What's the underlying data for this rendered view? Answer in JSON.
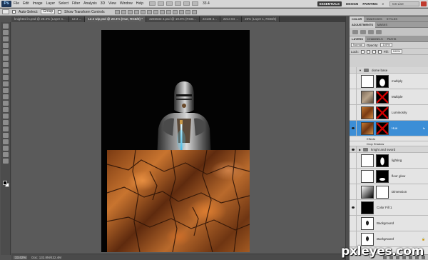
{
  "app": {
    "logo": "Ps",
    "menu": [
      "File",
      "Edit",
      "Image",
      "Layer",
      "Select",
      "Filter",
      "Analysis",
      "3D",
      "View",
      "Window",
      "Help"
    ],
    "zoom": "33.4",
    "workspaces": [
      "ESSENTIALS",
      "DESIGN",
      "PAINTING",
      "»"
    ],
    "cs_live": "CS Live"
  },
  "options": {
    "auto_select_label": "Auto-Select:",
    "auto_select_value": "Group",
    "show_transform_label": "Show Transform Controls"
  },
  "tabs": [
    "knighted in.psd @ 28.4% (Layer 4...",
    "12.4 ...",
    "12.4 wip.psd @ 28.4% (Hue, RGB/8) *",
    "3265533 4.psd @ 19.8% (RGB...",
    "22135 4...",
    "2214 84 ...",
    "26% (Layer 1, RGB/8)"
  ],
  "status": {
    "zoom": "33.42%",
    "doc": "Doc: 132.8M/432.4M"
  },
  "panels": {
    "top_tabs": [
      "COLOR",
      "SWATCHES",
      "STYLES"
    ],
    "mid_tabs": [
      "ADJUSTMENTS",
      "MASKS"
    ],
    "layer_tabs": [
      "LAYERS",
      "CHANNELS",
      "PATHS"
    ],
    "blend_mode": "Normal",
    "opacity_label": "Opacity:",
    "opacity_value": "100%",
    "lock_label": "Lock:",
    "fill_label": "Fill:",
    "fill_value": "100%"
  },
  "layers": [
    {
      "kind": "group",
      "name": "dome base"
    },
    {
      "kind": "layer",
      "name": "multiply"
    },
    {
      "kind": "layer",
      "name": "Multiple"
    },
    {
      "kind": "layer",
      "name": "Luminosity"
    },
    {
      "kind": "layer",
      "name": "Hue",
      "selected": true,
      "fx": "fx"
    },
    {
      "kind": "fxrow",
      "name": "Effects"
    },
    {
      "kind": "fxrow",
      "name": "Drop Shadow"
    },
    {
      "kind": "group",
      "name": "knight and sword"
    },
    {
      "kind": "layer",
      "name": "lighting"
    },
    {
      "kind": "layer",
      "name": "floor glow"
    },
    {
      "kind": "layer",
      "name": "Dimension"
    },
    {
      "kind": "layer",
      "name": "Color Fill 1"
    },
    {
      "kind": "layer",
      "name": "Background"
    },
    {
      "kind": "layer",
      "name": "Background"
    }
  ],
  "watermark": "pxleyes.com"
}
